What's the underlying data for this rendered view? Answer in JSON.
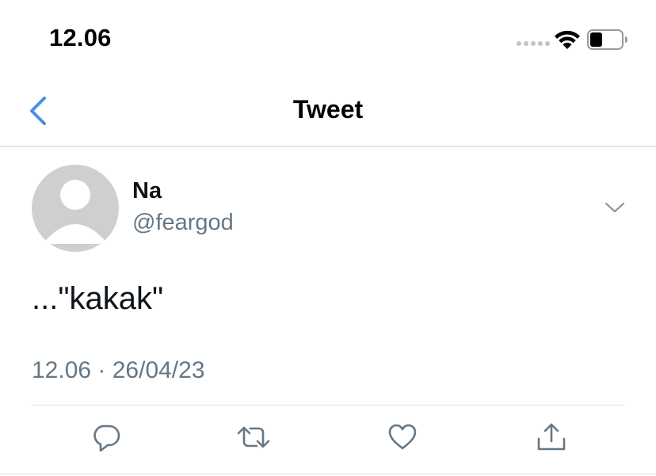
{
  "status_bar": {
    "time": "12.06"
  },
  "nav": {
    "title": "Tweet"
  },
  "tweet": {
    "author_name": "Na",
    "author_handle": "@feargod",
    "text": "...\"kakak\"",
    "timestamp": "12.06 · 26/04/23"
  },
  "icons": {
    "back": "chevron-left-icon",
    "more": "chevron-down-icon",
    "reply": "reply-icon",
    "retweet": "retweet-icon",
    "like": "heart-icon",
    "share": "share-icon"
  },
  "colors": {
    "accent": "#4a90e2",
    "muted_text": "#657786",
    "icon": "#657786",
    "avatar_bg": "#cfcfcf"
  }
}
